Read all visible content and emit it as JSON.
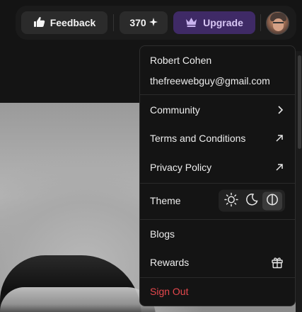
{
  "topbar": {
    "feedback_label": "Feedback",
    "credits_value": "370",
    "upgrade_label": "Upgrade"
  },
  "user": {
    "name": "Robert Cohen",
    "email": "thefreewebguy@gmail.com"
  },
  "menu": {
    "community": "Community",
    "terms": "Terms and Conditions",
    "privacy": "Privacy Policy",
    "theme": "Theme",
    "theme_options": [
      "light",
      "dark",
      "system"
    ],
    "theme_selected": "system",
    "blogs": "Blogs",
    "rewards": "Rewards",
    "sign_out": "Sign Out"
  },
  "icons": {
    "feedback": "thumbs-up-icon",
    "credits": "sparkle-icon",
    "upgrade": "crown-icon",
    "community": "chevron-right-icon",
    "terms": "external-arrow-icon",
    "privacy": "external-arrow-icon",
    "rewards": "gift-icon"
  },
  "colors": {
    "upgrade_bg": "#3f2a66",
    "upgrade_text": "#d7c6f3",
    "sign_out": "#e5484d"
  }
}
